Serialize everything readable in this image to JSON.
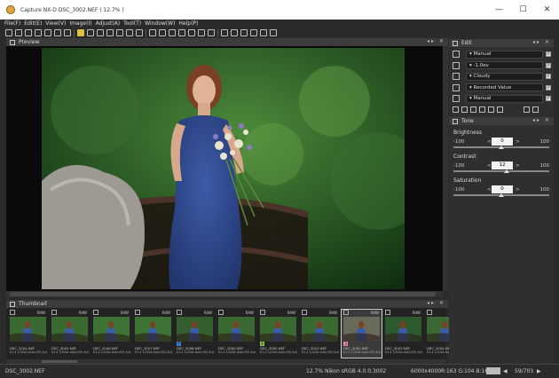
{
  "window": {
    "title": "Capture NX-D    DSC_3002.NEF ( 12.7% )",
    "minimize": "—",
    "maximize": "☐",
    "close": "✕"
  },
  "menu": [
    "File(F)",
    "Edit(E)",
    "View(V)",
    "Image(I)",
    "Adjust(A)",
    "Tool(T)",
    "Window(W)",
    "Help(P)"
  ],
  "preview": {
    "title": "Preview",
    "controls": "◂▸ ✕"
  },
  "thumbnail_panel": {
    "title": "Thumbnail",
    "controls": "◂▸ ✕"
  },
  "thumbnails": [
    {
      "name": "DSC_3004.NEF",
      "meta": "f/1.4 1/320s Auto ISO Aut",
      "raw": "RAW",
      "label": "",
      "selected": false
    },
    {
      "name": "DSC_3005.NEF",
      "meta": "f/1.4 1/320s Auto ISO Aut",
      "raw": "RAW",
      "label": "",
      "selected": false
    },
    {
      "name": "DSC_3006.NEF",
      "meta": "f/1.4 1/320s Auto ISO Aut",
      "raw": "RAW",
      "label": "",
      "selected": false
    },
    {
      "name": "DSC_3007.NEF",
      "meta": "f/1.4 1/320s Auto ISO Aut",
      "raw": "RAW",
      "label": "",
      "selected": false
    },
    {
      "name": "DSC_3008.NEF",
      "meta": "f/1.4 1/320s Auto ISO Aut",
      "raw": "RAW",
      "label": "7",
      "label_color": "#3a7bd5",
      "selected": false
    },
    {
      "name": "DSC_3000.NEF",
      "meta": "f/1.4 1/320s Auto ISO Aut",
      "raw": "RAW",
      "label": "",
      "selected": false
    },
    {
      "name": "DSC_3000.NEF",
      "meta": "f/1.4 1/320s Auto ISO Aut",
      "raw": "RAW",
      "label": "4",
      "label_color": "#8bc34a",
      "selected": false
    },
    {
      "name": "DSC_3001.NEF",
      "meta": "f/1.4 1/320s Auto ISO Aut",
      "raw": "RAW",
      "label": "",
      "selected": false
    },
    {
      "name": "DSC_3002.NEF",
      "meta": "f/1.4 1/320s Auto ISO Aut",
      "raw": "RAW",
      "label": "3",
      "label_color": "#e98fb0",
      "selected": true
    },
    {
      "name": "DSC_3003.NEF",
      "meta": "f/1.4 1/320s Auto ISO Aut",
      "raw": "RAW",
      "label": "",
      "selected": false
    },
    {
      "name": "DSC_3004.NEF",
      "meta": "f/1.4 1/320s Auto ISO Aut",
      "raw": "RAW",
      "label": "",
      "selected": false
    }
  ],
  "status": {
    "file": "DSC_3002.NEF",
    "zoom": "12.7%",
    "profile": "Nikon sRGB 4.0.0.3002",
    "size": "6000x4000",
    "rgb": "R:163 G:104 B:166",
    "nav_prev": "◀",
    "nav_next": "▶",
    "count": "59/703"
  },
  "edit_panel": {
    "title": "Edit",
    "controls": "◂▸ ✕",
    "rows": [
      {
        "icon": "gear-icon",
        "value": "Manual",
        "checked": true
      },
      {
        "icon": "exposure-icon",
        "value": "-1.0ev",
        "checked": true
      },
      {
        "icon": "white-balance-icon",
        "value": "Cloudy",
        "checked": true
      },
      {
        "icon": "picture-control-icon",
        "value": "Recorded Value",
        "checked": true
      },
      {
        "icon": "active-dlighting-icon",
        "value": "Manual",
        "checked": true
      }
    ]
  },
  "tone_panel": {
    "title": "Tone",
    "controls": "◂▸ ✕",
    "sliders": [
      {
        "label": "Brightness",
        "min": "-100",
        "max": "100",
        "value": "0",
        "position": 0.5
      },
      {
        "label": "Contrast",
        "min": "-100",
        "max": "100",
        "value": "12",
        "position": 0.56
      },
      {
        "label": "Saturation",
        "min": "-100",
        "max": "100",
        "value": "0",
        "position": 0.5
      }
    ],
    "lt": "<",
    "gt": ">"
  },
  "colors": {
    "accent": "#e0c23a",
    "background": "#2b2b2b",
    "panel": "#2f2f2f"
  }
}
